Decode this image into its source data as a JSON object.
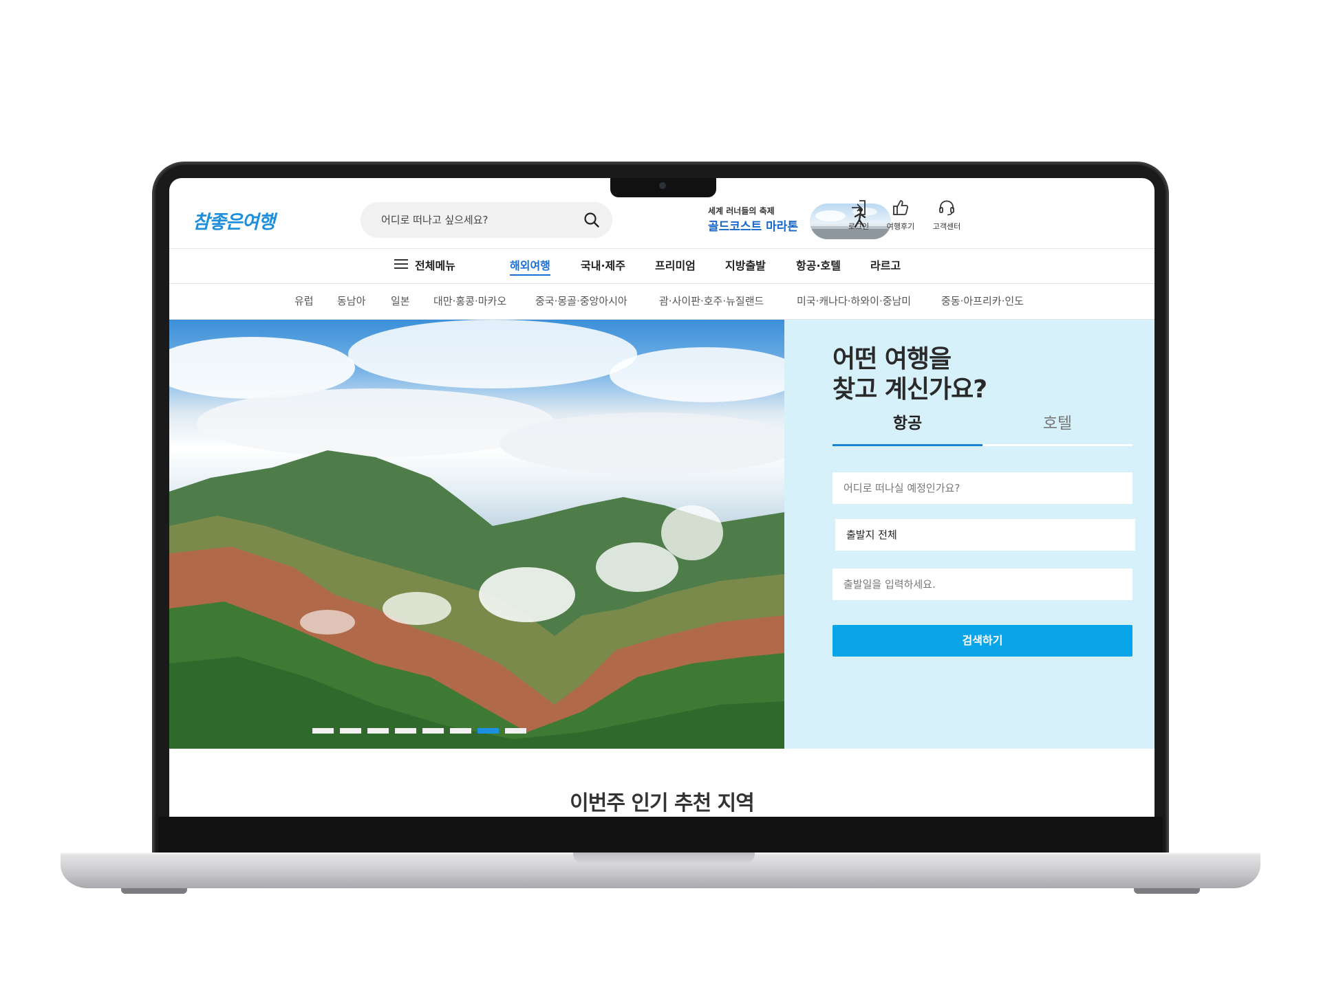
{
  "site": {
    "logo": "참좋은여행",
    "search_placeholder": "어디로 떠나고 싶으세요?",
    "promo": {
      "subtitle": "세계 러너들의 축제",
      "title": "골드코스트 마라톤"
    },
    "utility": [
      {
        "label": "로그인",
        "icon": "login-icon"
      },
      {
        "label": "여행후기",
        "icon": "thumbs-up-icon"
      },
      {
        "label": "고객센터",
        "icon": "headset-icon"
      }
    ]
  },
  "gnb": {
    "menu_all": "전체메뉴",
    "items": [
      "해외여행",
      "국내·제주",
      "프리미엄",
      "지방출발",
      "항공·호텔",
      "라르고"
    ],
    "active_index": 0
  },
  "sub_nav": {
    "items": [
      "유럽",
      "동남아",
      "일본",
      "대만·홍콩·마카오",
      "중국·몽골·중앙아시아",
      "괌·사이판·호주·뉴질랜드",
      "미국·캐나다·하와이·중남미",
      "중동·아프리카·인도"
    ]
  },
  "hero": {
    "slide_count": 8,
    "active_slide": 6
  },
  "search_panel": {
    "title": "어떤 여행을\n찾고 계신가요?",
    "tabs": [
      "항공",
      "호텔"
    ],
    "active_tab": 0,
    "destination_placeholder": "어디로 떠나실 예정인가요?",
    "departure_value": "출발지 전체",
    "date_placeholder": "출발일을 입력하세요.",
    "search_button": "검색하기"
  },
  "section": {
    "title": "이번주 인기 추천 지역"
  },
  "colors": {
    "brand_blue": "#1a6fd6",
    "panel_bg": "#d7f1fb",
    "button_blue": "#0aa4e8",
    "logo_blue": "#1f8fdc"
  }
}
